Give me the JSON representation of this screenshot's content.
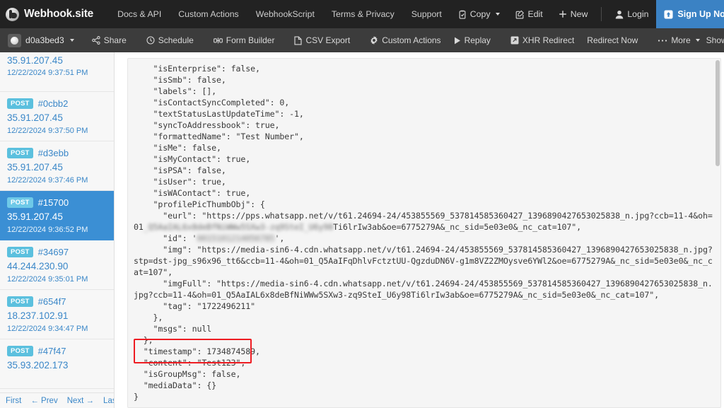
{
  "topnav": {
    "brand": "Webhook.site",
    "brand_icon": "webhook-logo-icon",
    "links": [
      {
        "label": "Docs & API",
        "name": "nav-link-docs-api"
      },
      {
        "label": "Custom Actions",
        "name": "nav-link-custom-actions"
      },
      {
        "label": "WebhookScript",
        "name": "nav-link-webhookscript"
      },
      {
        "label": "Terms & Privacy",
        "name": "nav-link-terms-privacy"
      },
      {
        "label": "Support",
        "name": "nav-link-support"
      }
    ],
    "actions": {
      "copy": "Copy",
      "copy_icon": "clipboard-check-icon",
      "edit": "Edit",
      "edit_icon": "pencil-square-icon",
      "new": "New",
      "new_icon": "plus-icon",
      "login": "Login",
      "login_icon": "user-icon",
      "signup": "Sign Up Now",
      "signup_icon": "upload-box-icon"
    },
    "colors": {
      "background": "#222222",
      "signup_button": "#3b82c4",
      "text": "#cdcdcd"
    }
  },
  "toolbar": {
    "token": "d0a3bed3",
    "token_icon": "token-dot-icon",
    "items": [
      {
        "label": "Share",
        "icon": "share-nodes-icon",
        "name": "toolbar-share"
      },
      {
        "label": "Schedule",
        "icon": "clock-icon",
        "name": "toolbar-schedule"
      },
      {
        "label": "Form Builder",
        "icon": "form-builder-icon",
        "name": "toolbar-form-builder"
      },
      {
        "label": "CSV Export",
        "icon": "file-icon",
        "name": "toolbar-csv-export"
      },
      {
        "label": "Custom Actions",
        "icon": "gear-icon",
        "name": "toolbar-custom-actions"
      },
      {
        "label": "Replay",
        "icon": "play-icon",
        "name": "toolbar-replay"
      },
      {
        "label": "XHR Redirect",
        "icon": "xhr-redirect-icon",
        "name": "toolbar-xhr-redirect"
      },
      {
        "label": "Redirect Now",
        "icon": "",
        "name": "toolbar-redirect-now"
      },
      {
        "label": "More",
        "icon": "ellipsis-icon",
        "name": "toolbar-more"
      }
    ],
    "show_in": "Show In",
    "colors": {
      "background": "#3c3c3c"
    }
  },
  "sidebar": {
    "requests": [
      {
        "method": "",
        "id": "",
        "ip": "35.91.207.45",
        "date": "12/22/2024 9:37:51 PM",
        "selected": false,
        "partial": true
      },
      {
        "method": "POST",
        "id": "#0cbb2",
        "ip": "35.91.207.45",
        "date": "12/22/2024 9:37:50 PM",
        "selected": false,
        "partial": false
      },
      {
        "method": "POST",
        "id": "#d3ebb",
        "ip": "35.91.207.45",
        "date": "12/22/2024 9:37:46 PM",
        "selected": false,
        "partial": false
      },
      {
        "method": "POST",
        "id": "#15700",
        "ip": "35.91.207.45",
        "date": "12/22/2024 9:36:52 PM",
        "selected": true,
        "partial": false
      },
      {
        "method": "POST",
        "id": "#34697",
        "ip": "44.244.230.90",
        "date": "12/22/2024 9:35:01 PM",
        "selected": false,
        "partial": false
      },
      {
        "method": "POST",
        "id": "#654f7",
        "ip": "18.237.102.91",
        "date": "12/22/2024 9:34:47 PM",
        "selected": false,
        "partial": false
      },
      {
        "method": "POST",
        "id": "#47f47",
        "ip": "35.93.202.173",
        "date": "",
        "selected": false,
        "partial": false
      }
    ],
    "pager": {
      "first": "First",
      "prev": "← Prev",
      "next": "Next →",
      "last": "Last"
    },
    "colors": {
      "selected_background": "#3b8fd4",
      "badge": "#5bc0de",
      "link": "#3a87c8"
    }
  },
  "content": {
    "json_part_1": "    \"isEnterprise\": false,\n    \"isSmb\": false,\n    \"labels\": [],\n    \"isContactSyncCompleted\": 0,\n    \"textStatusLastUpdateTime\": -1,\n    \"syncToAddressbook\": true,\n    \"formattedName\": \"Test Number\",\n    \"isMe\": false,\n    \"isMyContact\": true,\n    \"isPSA\": false,\n    \"isUser\": true,\n    \"isWAContact\": true,\n    \"profilePicThumbObj\": {\n      \"eurl\": \"https://pps.whatsapp.net/v/t61.24694-24/453855569_537814585360427_1396890427653025838_n.jpg?ccb=11-4&oh=01",
    "json_blur_url": "_Q5AaIAL6x8deBfNiWWw5SXw3-zq9SteI_U6y98",
    "json_part_2": "Ti6lrIw3ab&oe=6775279A&_nc_sid=5e03e0&_nc_cat=107\",\n      \"id\": '",
    "json_blur_id": "0015101214056785",
    "json_part_3": "',\n      \"img\": \"https://media-sin6-4.cdn.whatsapp.net/v/t61.24694-24/453855569_537814585360427_1396890427653025838_n.jpg?stp=dst-jpg_s96x96_tt6&ccb=11-4&oh=01_Q5AaIFqDhlvFctztUU-QgzduDN6V-g1m8VZ2ZMOysve6YWl2&oe=6775279A&_nc_sid=5e03e0&_nc_cat=107\",\n      \"imgFull\": \"https://media-sin6-4.cdn.whatsapp.net/v/t61.24694-24/453855569_537814585360427_1396890427653025838_n.jpg?ccb=11-4&oh=01_Q5AaIAL6x8deBfNiWWw5SXw3-zq9SteI_U6y98Ti6lrIw3ab&oe=6775279A&_nc_sid=5e03e0&_nc_cat=107\",\n      \"tag\": \"1722496211\"\n    },\n    \"msgs\": null\n  },\n  \"timestamp\": 1734874589,\n  \"content\": \"Test123\",\n  \"isGroupMsg\": false,\n  \"mediaData\": {}\n}",
    "highlight": {
      "color": "#ee1c22",
      "lines": [
        "\"timestamp\": 1734874589,",
        "\"content\": \"Test123\","
      ]
    }
  }
}
